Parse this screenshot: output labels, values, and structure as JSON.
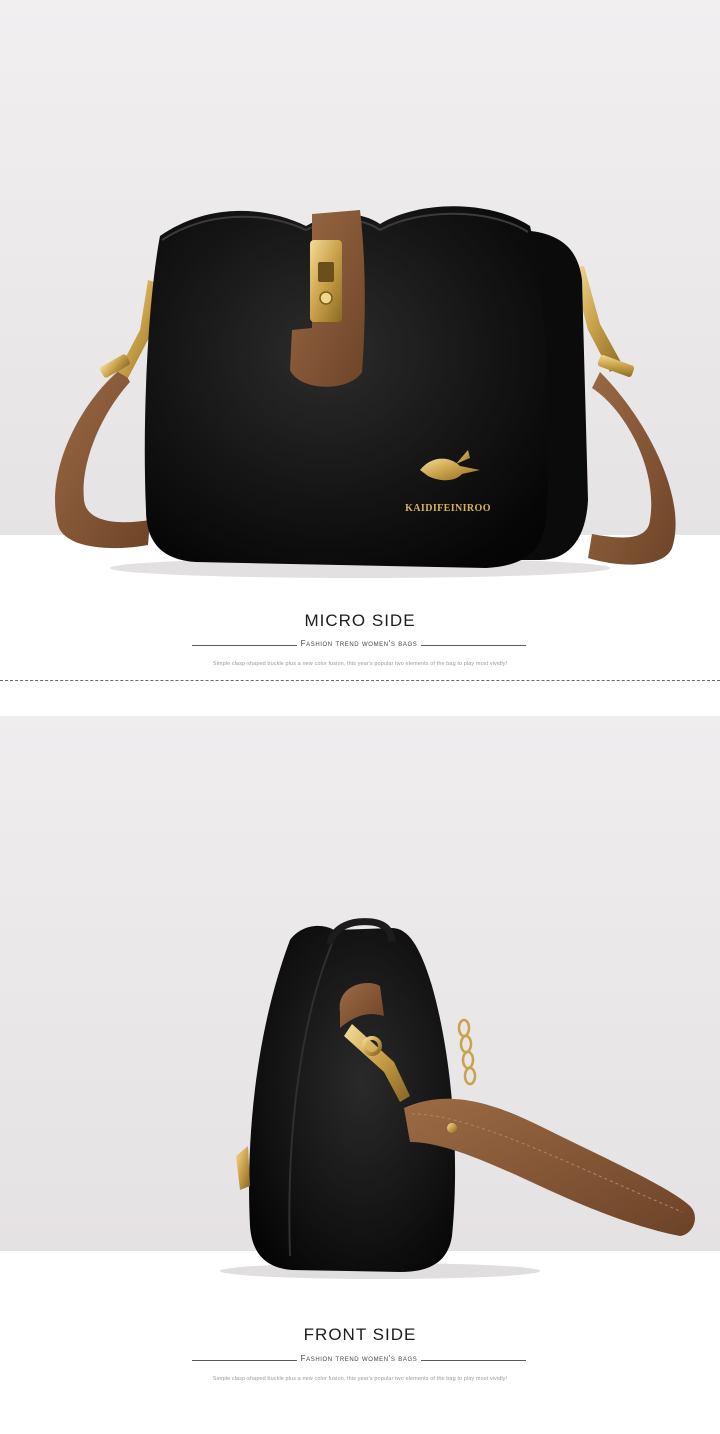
{
  "sections": [
    {
      "title": "MICRO SIDE",
      "subtitle": "Fashion trend women's bags",
      "description": "Simple clasp-shaped buckle plus a new color fusion, this year's popular two elements of the bag to play most vividly!"
    },
    {
      "title": "FRONT SIDE",
      "subtitle": "Fashion trend women's bags",
      "description": "Simple clasp-shaped buckle plus a new color fusion, this year's popular two elements of the bag to play most vividly!"
    }
  ],
  "product": {
    "logo_text": "KAIDIFEINIROO",
    "colors": {
      "leather": "#141414",
      "strap": "#8a5a3a",
      "hardware": "#d8b35a"
    }
  }
}
